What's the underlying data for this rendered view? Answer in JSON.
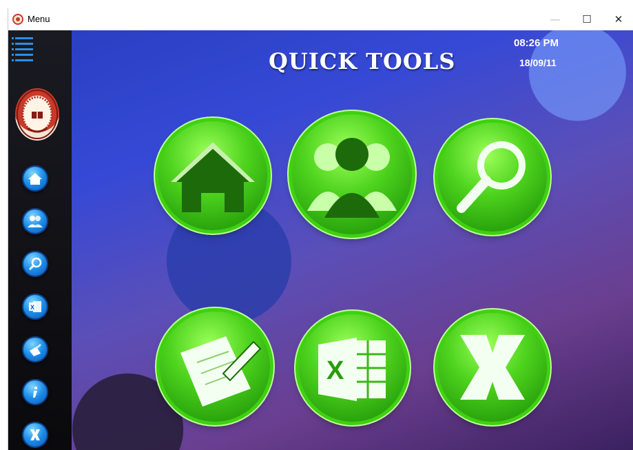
{
  "window": {
    "title": "Menu",
    "icon": "app-logo-icon",
    "minimize_glyph": "—",
    "maximize_glyph": "☐",
    "close_glyph": "✕"
  },
  "sidebar": {
    "items": [
      {
        "name": "menu-icon"
      },
      {
        "name": "institution-logo"
      },
      {
        "name": "home-icon"
      },
      {
        "name": "users-icon"
      },
      {
        "name": "search-icon"
      },
      {
        "name": "excel-icon"
      },
      {
        "name": "edit-icon"
      },
      {
        "name": "info-icon"
      },
      {
        "name": "exit-icon"
      }
    ]
  },
  "header": {
    "title": "QUICK TOOLS",
    "time": "08:26 PM",
    "date": "18/09/11"
  },
  "tools": [
    {
      "name": "home-icon"
    },
    {
      "name": "users-icon"
    },
    {
      "name": "search-icon"
    },
    {
      "name": "notes-edit-icon"
    },
    {
      "name": "excel-icon"
    },
    {
      "name": "exit-icon"
    }
  ],
  "colors": {
    "accent_green": "#4fd41e",
    "sidebar_blue": "#1e8ee8",
    "sidebar_bg": "#101015"
  }
}
